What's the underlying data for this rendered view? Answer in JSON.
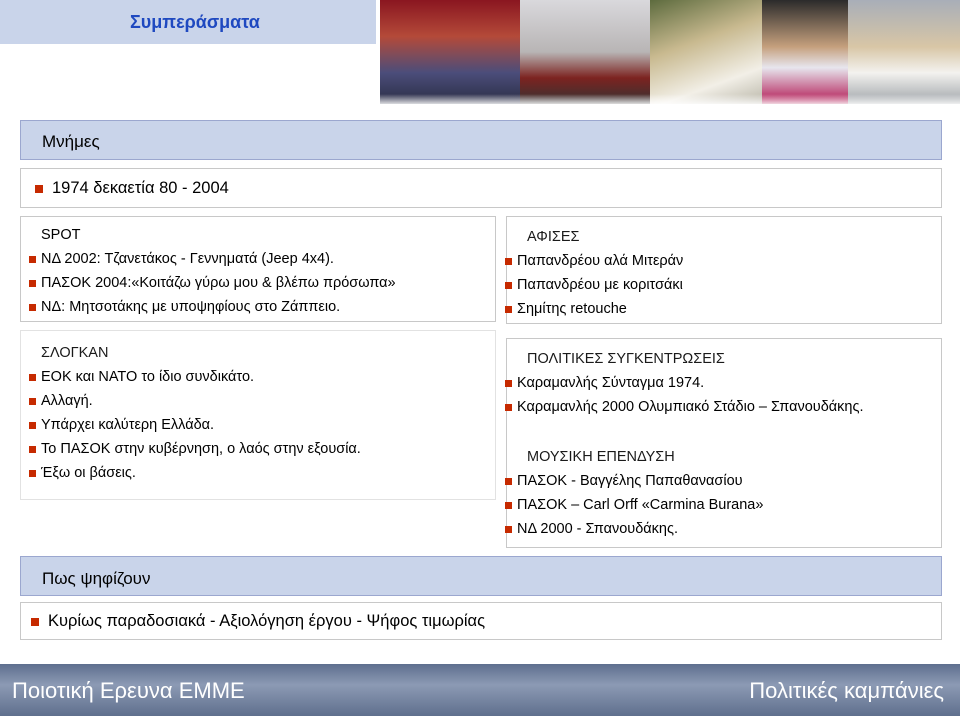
{
  "header": {
    "title": "Συμπεράσματα"
  },
  "photos": [
    "photo-crowd",
    "photo-couch",
    "photo-phone",
    "photo-man-tie",
    "photo-newspaper"
  ],
  "memories": {
    "heading": "Μνήμες",
    "timeline": "1974   δεκαετία 80 - 2004"
  },
  "spot": {
    "heading": "SPOT",
    "items": [
      "ΝΔ 2002: Τζανετάκος - Γεννηματά (Jeep 4x4).",
      "ΠΑΣΟΚ 2004:«Κοιτάζω γύρω μου & βλέπω πρόσωπα»",
      "ΝΔ: Μητσοτάκης με υποψηφίους στο Ζάππειο."
    ]
  },
  "slogans": {
    "heading": "ΣΛΟΓΚΑΝ",
    "items": [
      "ΕΟΚ και ΝΑΤΟ το ίδιο συνδικάτο.",
      "Αλλαγή.",
      "Υπάρχει καλύτερη Ελλάδα.",
      "Το ΠΑΣΟΚ  στην κυβέρνηση, ο λαός στην εξουσία.",
      "Έξω οι βάσεις."
    ]
  },
  "posters": {
    "heading": "ΑΦΙΣΕΣ",
    "items": [
      "Παπανδρέου αλά Μιτεράν",
      "Παπανδρέου με κοριτσάκι",
      "Σημίτης retouche"
    ]
  },
  "rallies": {
    "heading": "ΠΟΛΙΤΙΚΕΣ ΣΥΓΚΕΝΤΡΩΣΕΙΣ",
    "items": [
      "Καραμανλής Σύνταγμα 1974.",
      "Καραμανλής 2000 Ολυμπιακό Στάδιο – Σπανουδάκης."
    ]
  },
  "music": {
    "heading": "ΜΟΥΣΙΚΗ ΕΠΕΝΔΥΣΗ",
    "items": [
      "ΠΑΣΟΚ - Βαγγέλης Παπαθανασίου",
      "ΠΑΣΟΚ – Carl Orff «Carmina Burana»",
      "ΝΔ 2000 - Σπανουδάκης."
    ]
  },
  "voting": {
    "heading": "Πως ψηφίζουν",
    "summary": "Κυρίως παραδοσιακά - Αξιολόγηση έργου - Ψήφος τιμωρίας"
  },
  "footer": {
    "left": "Ποιοτική Ερευνα ΕΜΜΕ",
    "right": "Πολιτικές καμπάνιες"
  },
  "colors": {
    "accent_band": "#c9d4ea",
    "title_text": "#1f49c0",
    "bullet": "#c62a00",
    "footer": "#6b7a97"
  }
}
